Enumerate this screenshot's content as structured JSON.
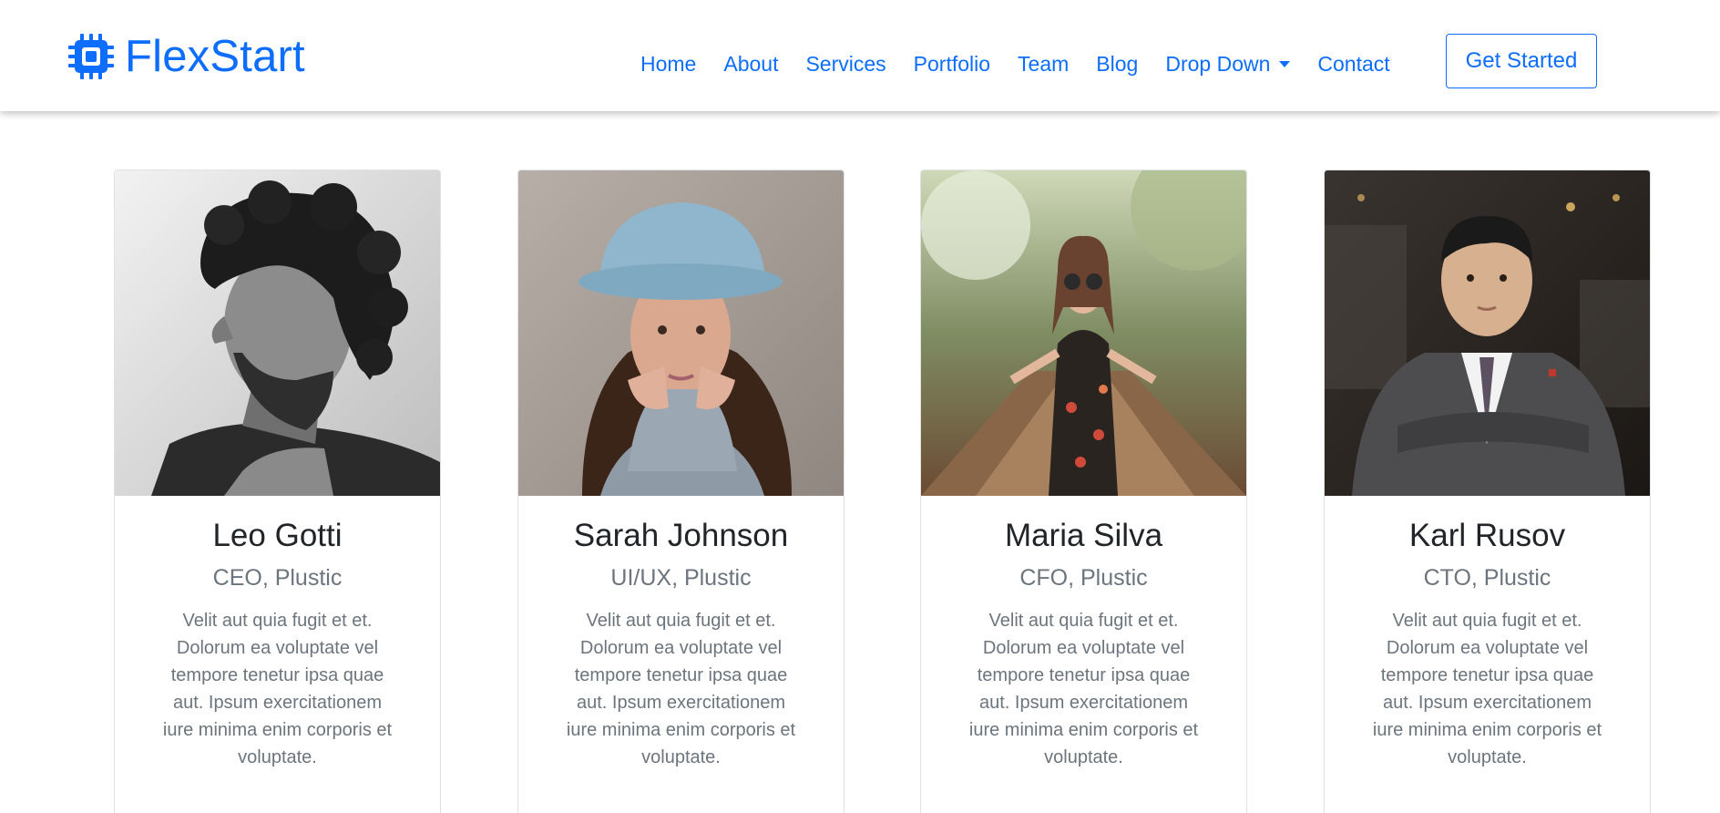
{
  "brand": {
    "name": "FlexStart",
    "icon": "cpu-chip-icon",
    "color": "#0d6efd"
  },
  "nav": {
    "items": [
      {
        "label": "Home"
      },
      {
        "label": "About"
      },
      {
        "label": "Services"
      },
      {
        "label": "Portfolio"
      },
      {
        "label": "Team"
      },
      {
        "label": "Blog"
      },
      {
        "label": "Drop Down",
        "has_caret": true
      },
      {
        "label": "Contact"
      }
    ],
    "cta_label": "Get Started"
  },
  "team": {
    "members": [
      {
        "name": "Leo Gotti",
        "role": "CEO, Plustic",
        "bio": "Velit aut quia fugit et et. Dolorum ea voluptate vel tempore tenetur ipsa quae aut. Ipsum exercitationem iure minima enim corporis et voluptate."
      },
      {
        "name": "Sarah Johnson",
        "role": "UI/UX, Plustic",
        "bio": "Velit aut quia fugit et et. Dolorum ea voluptate vel tempore tenetur ipsa quae aut. Ipsum exercitationem iure minima enim corporis et voluptate."
      },
      {
        "name": "Maria Silva",
        "role": "CFO, Plustic",
        "bio": "Velit aut quia fugit et et. Dolorum ea voluptate vel tempore tenetur ipsa quae aut. Ipsum exercitationem iure minima enim corporis et voluptate."
      },
      {
        "name": "Karl Rusov",
        "role": "CTO, Plustic",
        "bio": "Velit aut quia fugit et et. Dolorum ea voluptate vel tempore tenetur ipsa quae aut. Ipsum exercitationem iure minima enim corporis et voluptate."
      }
    ]
  },
  "colors": {
    "accent": "#0d6efd",
    "muted_text": "#6c757d",
    "heading_text": "#212529",
    "card_border": "#dee2e6"
  }
}
